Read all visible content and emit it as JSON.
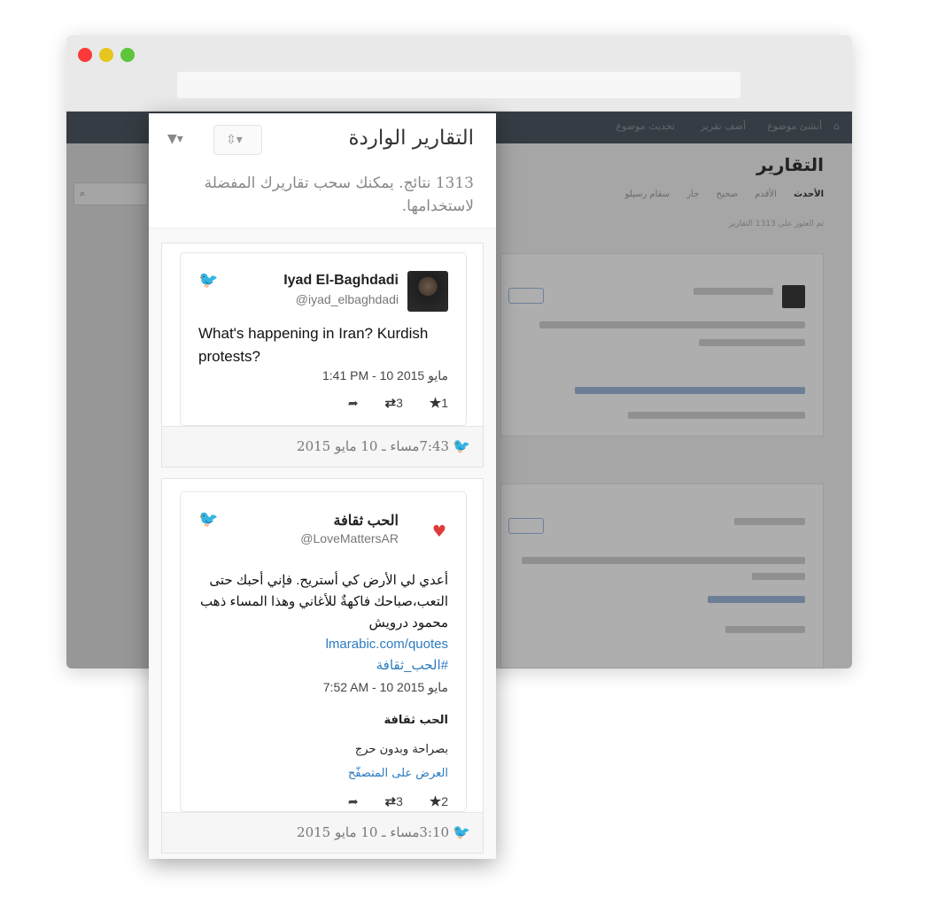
{
  "browser": {
    "colors": {
      "close": "#fc3a3a",
      "minimize": "#e6c51f",
      "maximize": "#5cc53a"
    }
  },
  "background_app": {
    "nav": [
      "أنشئ موضوع",
      "أضف تقرير",
      "تحديث موضوع"
    ],
    "page_title": "التقارير",
    "tabs": [
      "الأحدث",
      "الأقدم",
      "صحيح",
      "جار",
      "سقام رسيلو"
    ],
    "count_text": "تم العثور على 1313 التقارير",
    "search_icon": "search-icon"
  },
  "panel": {
    "title": "التقارير الواردة",
    "description": "1313 نتائج. يمكنك سحب تقاريرك المفضلة لاستخدامها.",
    "sort_icon": "sort-icon",
    "filter_icon": "filter-icon"
  },
  "reports": [
    {
      "time": "7:43مساء ـ 10 مايو 2015",
      "tweet": {
        "name": "Iyad El-Baghdadi",
        "handle": "@iyad_elbaghdadi",
        "text": "What's happening in Iran? Kurdish protests?",
        "date": "1:41 PM - 10 مايو 2015",
        "retweets": "3",
        "favorites": "1"
      }
    },
    {
      "time": "3:10مساء ـ 10 مايو 2015",
      "tweet": {
        "name": "الحب ثقافة",
        "handle": "@LoveMattersAR",
        "text_line_1": "أعدي لي الأرض كي أستريح. فإني أحبك حتى التعب،صباحك فاكهةٌ للأغاني وهذا المساء ذهب",
        "text_line_2": "محمود درويش",
        "link": "lmarabic.com/quotes",
        "hashtag": "#الحب_ثقافة",
        "date": "7:52 AM - 10 مايو 2015",
        "card_title": "الحب ثقافة",
        "card_subtitle": "بصراحة وبدون حرج",
        "card_link": "العرض على المتصفّح",
        "retweets": "3",
        "favorites": "2"
      }
    }
  ]
}
